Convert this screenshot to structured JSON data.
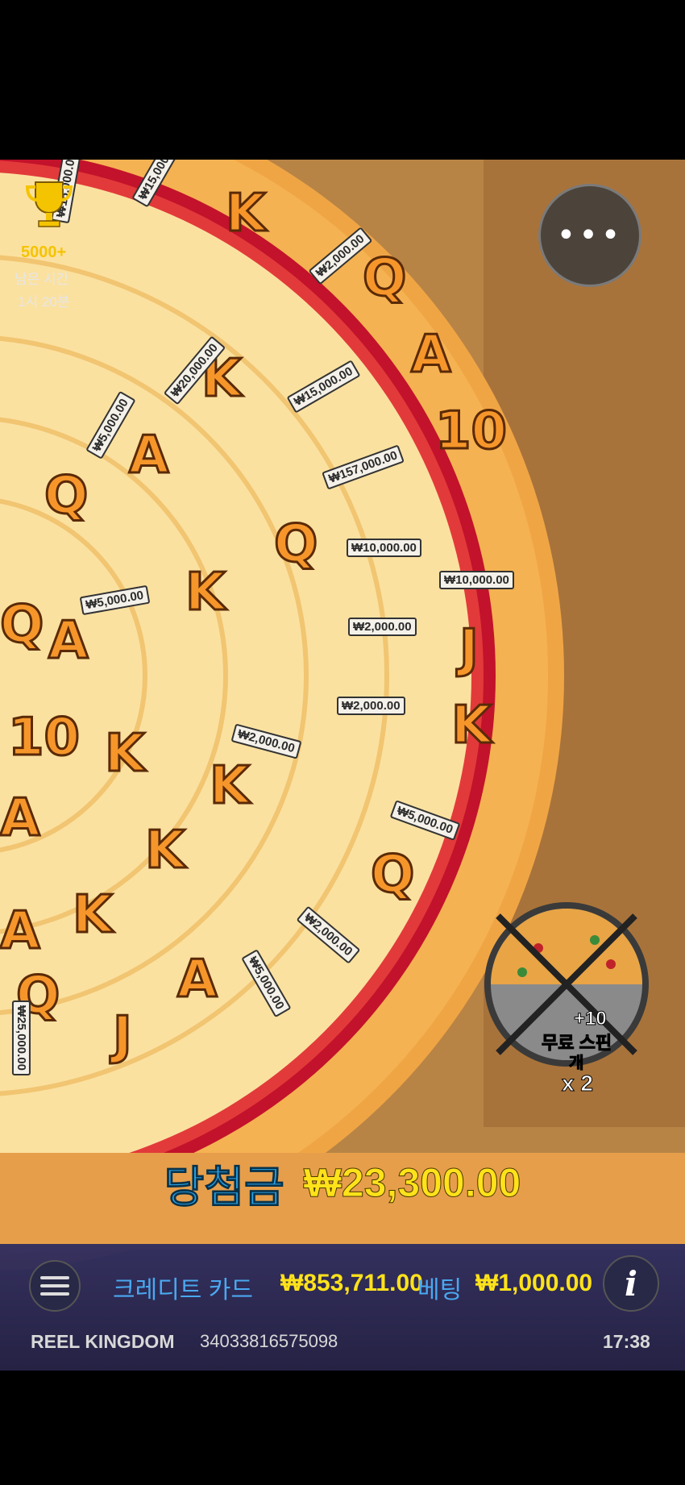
{
  "hud": {
    "trophy_count": "5000+",
    "remaining_label": "남은 시간",
    "remaining_value": "1시 20분",
    "menu_icon": "more-dots-icon"
  },
  "reels": {
    "letters": [
      "K",
      "Q",
      "A",
      "K",
      "Q",
      "A",
      "10",
      "Q",
      "A",
      "K",
      "Q",
      "J",
      "K",
      "K",
      "K",
      "A",
      "Q",
      "K",
      "A",
      "J",
      "A",
      "10",
      "Q",
      "K"
    ],
    "chips": [
      "₩15,000.00",
      "₩2,000.00",
      "₩20,000.00",
      "₩5,000.00",
      "₩15,000.00",
      "₩157,000.00",
      "₩10,000.00",
      "₩10,000.00",
      "₩5,000.00",
      "₩2,000.00",
      "₩2,000.00",
      "₩2,000.00",
      "₩5,000.00",
      "₩2,000.00",
      "₩5,000.00",
      "₩25,000.00",
      "₩15,000.00"
    ]
  },
  "bonus": {
    "plus": "+10",
    "label": "무료 스핀",
    "unit": "개",
    "multiplier": "x 2"
  },
  "win": {
    "label": "당첨금",
    "value": "₩23,300.00"
  },
  "bottom": {
    "credit_label": "크레디트 카드",
    "credit_value": "₩853,711.00",
    "bet_label": "베팅",
    "bet_value": "₩1,000.00",
    "brand": "REEL KINGDOM",
    "round_id": "34033816575098",
    "clock": "17:38"
  },
  "colors": {
    "win_label": "#2aa4e8",
    "win_value": "#ffe21a",
    "credit_label": "#4aa8f0",
    "bar_bg": "#22224f"
  }
}
